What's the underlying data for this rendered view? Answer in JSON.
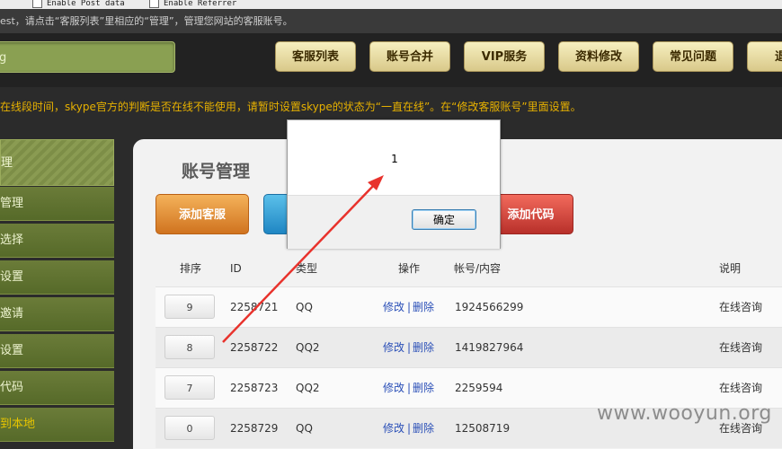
{
  "topbar": {
    "options": [
      "Enable Post data",
      "Enable Referrer"
    ]
  },
  "infobar": {
    "text": "est，请点击“客服列表”里相应的“管理”，管理您网站的客服账号。"
  },
  "search": {
    "value": "g"
  },
  "nav": {
    "buttons": [
      "客服列表",
      "账号合并",
      "VIP服务",
      "资料修改",
      "常见问题",
      "退"
    ]
  },
  "notice": {
    "text": "在线段时间，skype官方的判断是否在线不能使用，请暂时设置skype的状态为“一直在线”。在“修改客服账号”里面设置。"
  },
  "sidebar": {
    "items": [
      "理",
      "管理",
      "选择",
      "设置",
      "邀请",
      "设置",
      "代码",
      "到本地"
    ]
  },
  "main": {
    "title": "账号管理",
    "actions": {
      "add_service": "添加客服",
      "add_code": "添加代码"
    },
    "table": {
      "headers": [
        "排序",
        "ID",
        "类型",
        "操作",
        "帐号/内容",
        "说明"
      ],
      "edit_label": "修改",
      "sep": "|",
      "delete_label": "删除",
      "rows": [
        {
          "order": "9",
          "id": "2258721",
          "type": "QQ",
          "account": "1924566299",
          "desc": "在线咨询"
        },
        {
          "order": "8",
          "id": "2258722",
          "type": "QQ2",
          "account": "1419827964",
          "desc": "在线咨询"
        },
        {
          "order": "7",
          "id": "2258723",
          "type": "QQ2",
          "account": "2259594",
          "desc": "在线咨询"
        },
        {
          "order": "0",
          "id": "2258729",
          "type": "QQ",
          "account": "12508719",
          "desc": "在线咨询"
        }
      ]
    }
  },
  "dialog": {
    "message": "1",
    "ok_label": "确定"
  },
  "watermark": "www.wooyun.org",
  "colors": {
    "nav_button": "#e9dda1",
    "notice_text": "#e7b100",
    "sidebar": "#5f7230",
    "arrow": "#e8322c"
  }
}
